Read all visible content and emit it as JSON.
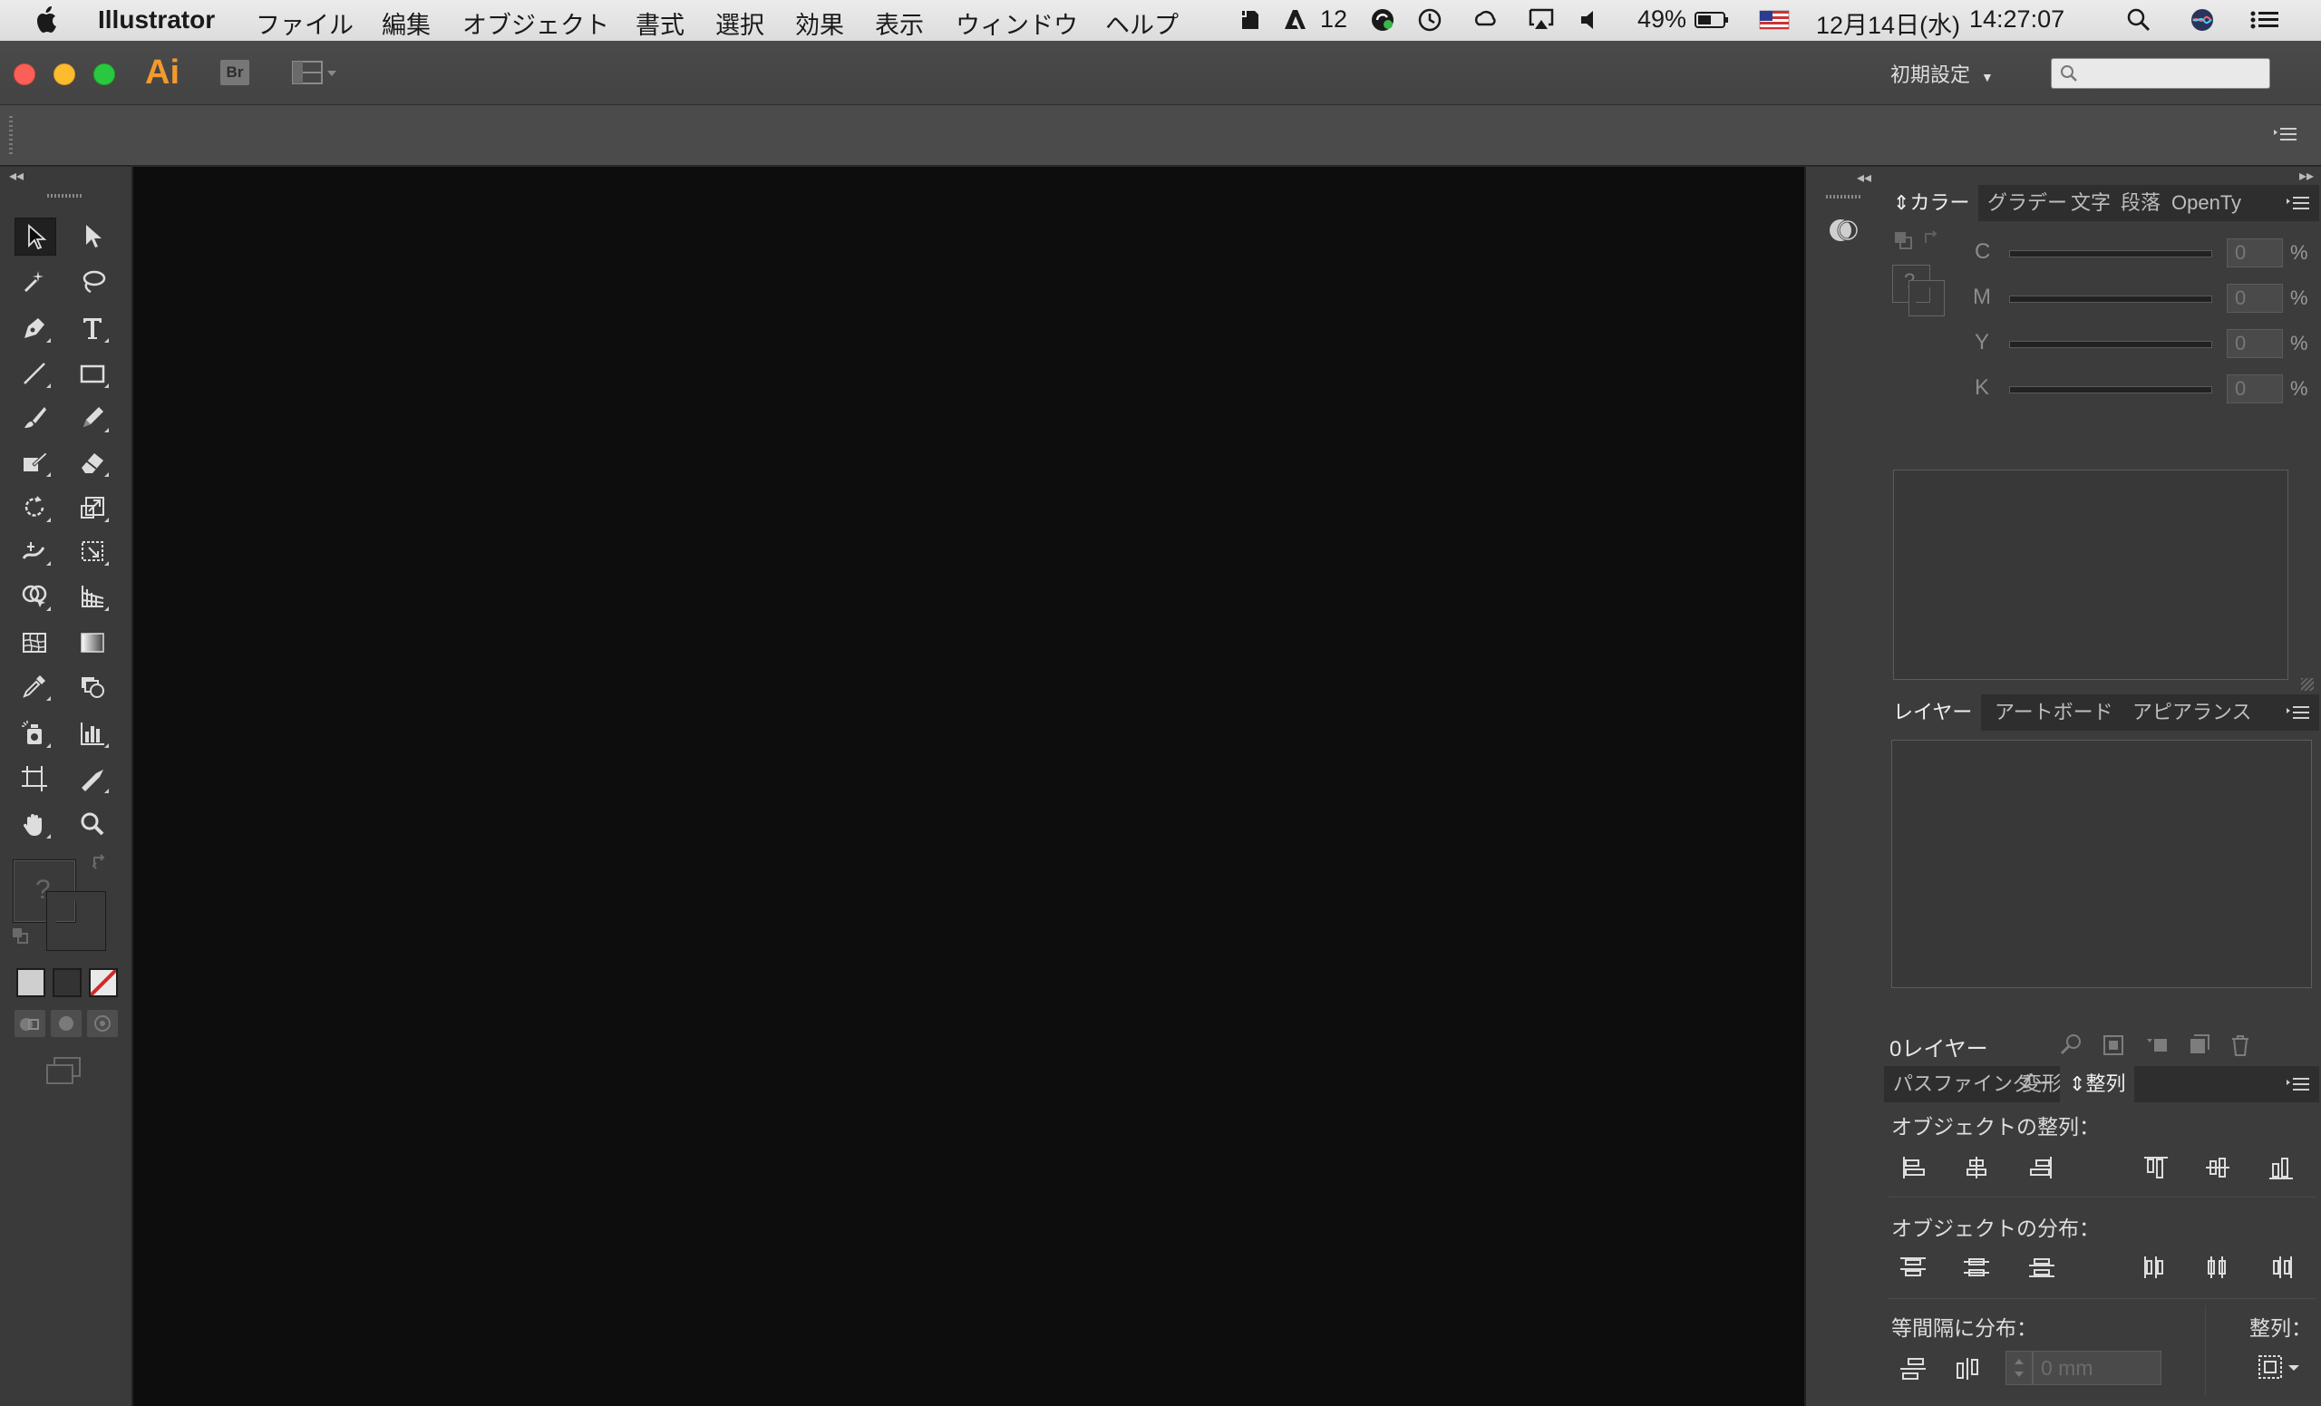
{
  "menubar": {
    "app_name": "Illustrator",
    "items": [
      "ファイル",
      "編集",
      "オブジェクト",
      "書式",
      "選択",
      "効果",
      "表示",
      "ウィンドウ",
      "ヘルプ"
    ],
    "status": {
      "adobe_count": "12",
      "battery": "49%",
      "date": "12月14日(水)",
      "time": "14:27:07"
    }
  },
  "appbar": {
    "logo": "Ai",
    "bridge": "Br",
    "workspace": "初期設定",
    "search_placeholder": ""
  },
  "color_panel": {
    "tabs": [
      "カラー",
      "グラデー",
      "文字",
      "段落",
      "OpenTy"
    ],
    "rows": [
      {
        "label": "C",
        "value": "0"
      },
      {
        "label": "M",
        "value": "0"
      },
      {
        "label": "Y",
        "value": "0"
      },
      {
        "label": "K",
        "value": "0"
      }
    ],
    "unit": "%",
    "unknown": "?"
  },
  "layers_panel": {
    "tabs": [
      "レイヤー",
      "アートボード",
      "アピアランス"
    ],
    "footer_count": "0レイヤー"
  },
  "align_panel": {
    "tabs": [
      "パスファインダー",
      "変形",
      "整列"
    ],
    "align_objects": "オブジェクトの整列：",
    "distribute_objects": "オブジェクトの分布：",
    "distribute_spacing": "等間隔に分布：",
    "align_to": "整列：",
    "spacing_value": "0 mm"
  },
  "tools": {
    "fill_unknown": "?"
  },
  "colors": {
    "canvas": "#0d0d0d",
    "panel": "#3c3c3c",
    "accent_ai": "#f29a2e"
  }
}
